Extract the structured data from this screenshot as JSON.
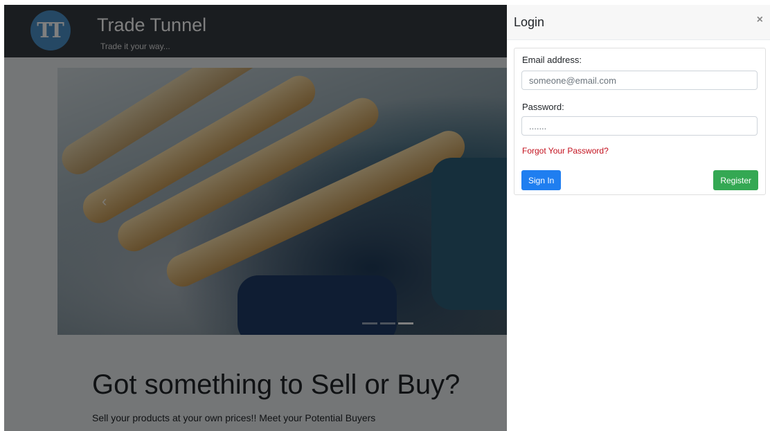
{
  "navbar": {
    "logo_text": "TT",
    "brand_title": "Trade Tunnel",
    "tagline": "Trade it your way..."
  },
  "carousel": {
    "prev_arrow": "‹",
    "indicators": 3,
    "active_indicator": 3
  },
  "jumbotron": {
    "title": "Got something to Sell or Buy?",
    "subtitle": "Sell your products at your own prices!! Meet your Potential Buyers"
  },
  "login": {
    "title": "Login",
    "close_label": "×",
    "email_label": "Email address:",
    "email_placeholder": "someone@email.com",
    "password_label": "Password:",
    "password_placeholder": ".......",
    "forgot_link": "Forgot Your Password?",
    "sign_in_label": "Sign In",
    "register_label": "Register"
  },
  "colors": {
    "navbar_bg": "#343a40",
    "primary": "#1f7ef0",
    "success": "#34a853",
    "danger_link": "#c3111e"
  }
}
